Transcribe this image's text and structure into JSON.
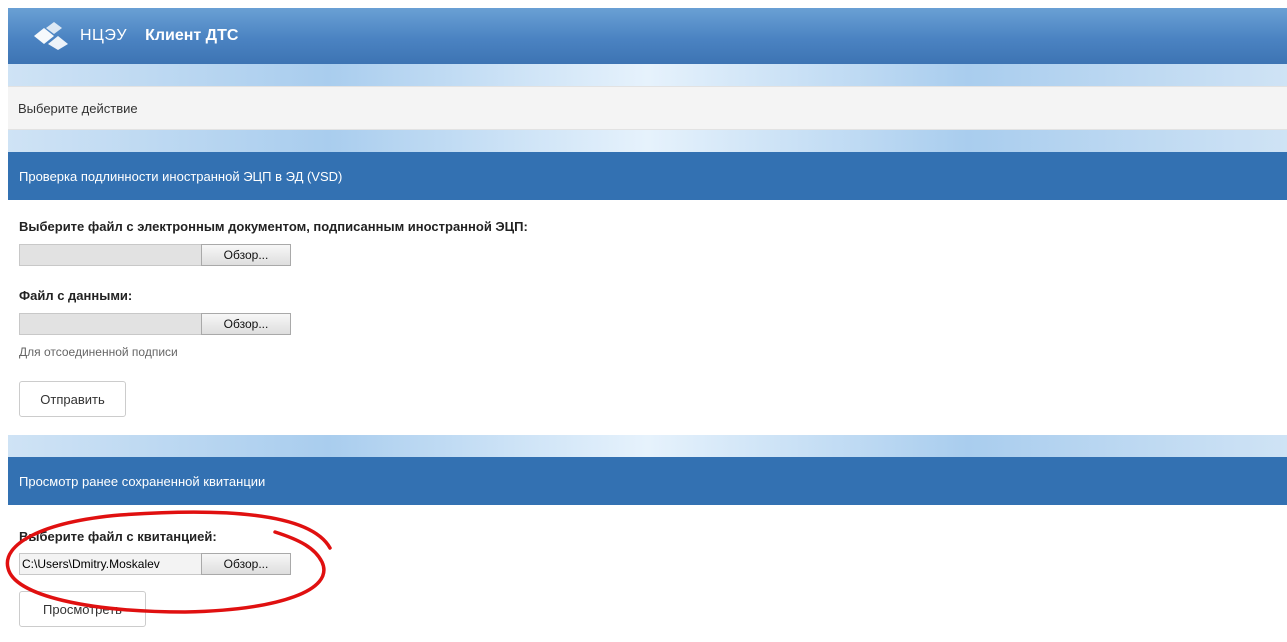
{
  "header": {
    "brand": "НЦЭУ",
    "app_title": "Клиент ДТС",
    "brand_color": "#4b83c2"
  },
  "action_prompt": "Выберите действие",
  "verify_section": {
    "title": "Проверка подлинности иностранной ЭЦП в ЭД (VSD)",
    "doc_file_label": "Выберите файл с электронным документом, подписанным иностранной ЭЦП:",
    "doc_file_value": "",
    "browse_label": "Обзор...",
    "data_file_label": "Файл с данными:",
    "data_file_value": "",
    "detached_hint": "Для отсоединенной подписи",
    "submit_label": "Отправить"
  },
  "receipt_section": {
    "title": "Просмотр ранее сохраненной квитанции",
    "receipt_file_label": "Выберите файл с квитанцией:",
    "receipt_file_value": "C:\\Users\\Dmitry.Moskalev",
    "browse_label": "Обзор...",
    "view_label": "Просмотреть"
  },
  "colors": {
    "section_header": "#3371b2",
    "annotation": "#e01010"
  }
}
